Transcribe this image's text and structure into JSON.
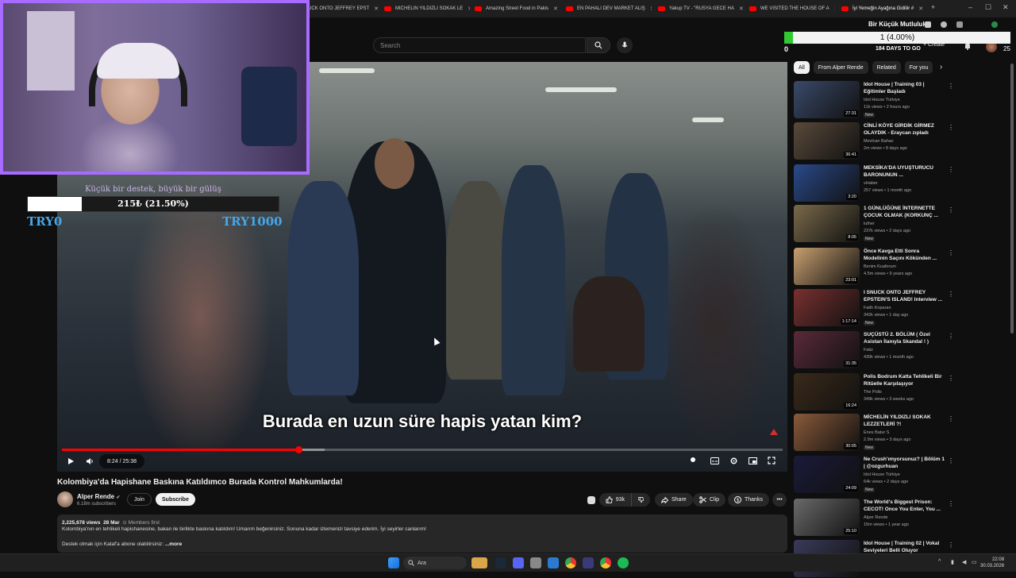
{
  "browser": {
    "tabs": [
      {
        "label": "UCK ONTO JEFFREY EPST"
      },
      {
        "label": "MICHELIN YILDIZLI SOKAK LE"
      },
      {
        "label": "Amazing Street Food in Pakis"
      },
      {
        "label": "EN PAHALI DEV MARKET ALIŞ"
      },
      {
        "label": "Yakup TV - \"RUSYA GECE HA"
      },
      {
        "label": "WE VISITED THE HOUSE OF A"
      },
      {
        "label": "İyi Yemeğin Ayağına Gidiliir #"
      }
    ],
    "new_tab": "+",
    "min": "–",
    "max": "☐",
    "close": "✕"
  },
  "youtube": {
    "search_placeholder": "Search",
    "create_label": "+ Create",
    "notif_count": "9+"
  },
  "overlay_goal": {
    "title": "Bir Küçük Mutluluk",
    "progress_text": "1 (4.00%)",
    "progress_percent": 4,
    "left_value": "0",
    "right_value": "25",
    "days_left": "184 DAYS TO GO"
  },
  "donation": {
    "title": "Küçük bir destek, büyük bir gülüş",
    "progress_text": "215₺ (21.50%)",
    "progress_percent": 21.5,
    "min_label": "TRY0",
    "max_label": "TRY1000"
  },
  "video": {
    "subtitle": "Burada en uzun süre hapis yatan kim?",
    "time": "8:24 / 25:38",
    "progress_percent": 32.8,
    "buffered_percent": 36.5,
    "title": "Kolombiya'da Hapishane Baskına Katıldımco Burada Kontrol Mahkumlarda!"
  },
  "channel": {
    "name": "Alper Rende",
    "subs": "6.18m subscribers",
    "join": "Join",
    "subscribe": "Subscribe"
  },
  "actions": {
    "likes": "93k",
    "share": "Share",
    "clip": "Clip",
    "thanks": "Thanks",
    "more": "•••"
  },
  "description": {
    "views": "2,225,678 views",
    "date": "28 Mar",
    "members": "Members first",
    "line1": "Kolombiya'nın en tehlikeli hapishanesine, bakan ile birlikte baskına katıldım! Umarım beğenirsiniz. Sonuna kadar izlemenizi tavsiye ederim. İyi seyirler canlarım!",
    "line2": "Destek olmak için Kataf'a abone olabilirsiniz:",
    "more": "...more"
  },
  "sidebar": {
    "chips": [
      {
        "label": "All"
      },
      {
        "label": "From Alper Rende"
      },
      {
        "label": "Related"
      },
      {
        "label": "For you"
      }
    ],
    "recs": [
      {
        "title": "Idol House | Training 03 | Eğitimler Başladı",
        "channel": "Idol House Türkiye",
        "meta": "11k views • 2 hours ago",
        "badge": "New",
        "dur": "27:31",
        "color": "#3a4a6a"
      },
      {
        "title": "CİNLİ KÖYE GİRDİK GİRMEZ OLAYDIK - Eraycan zıpladı",
        "channel": "Mevlcan Bahav",
        "meta": "2m views • 8 days ago",
        "badge": "",
        "dur": "36:41",
        "color": "#5a4a3a"
      },
      {
        "title": "MEKSİKA'DA UYUŞTURUCU BARONUNUN ...",
        "channel": "vHaber",
        "meta": "257 views • 1 month ago",
        "badge": "",
        "dur": "3:20",
        "color": "#2a4a8a"
      },
      {
        "title": "1 GÜNLÜĞÜNE İNTERNETTE ÇOCUK OLMAK (KORKUNÇ ...",
        "channel": "luther",
        "meta": "237k views • 2 days ago",
        "badge": "New",
        "dur": "8:05",
        "color": "#7a6a4a"
      },
      {
        "title": "Önce Kavga Etti Sonra Modelinin Saçını Kökünden ...",
        "channel": "Benim Kuaforum",
        "meta": "4.5m views • 9 years ago",
        "badge": "",
        "dur": "23:01",
        "color": "#c8a070"
      },
      {
        "title": "I SNUCK ONTO JEFFREY EPSTEIN'S ISLAND! Interview ...",
        "channel": "Fatih Koparan",
        "meta": "342k views • 1 day ago",
        "badge": "New",
        "dur": "1:17:14",
        "color": "#7a3030"
      },
      {
        "title": "SUÇÜSTÜ 2. BÖLÜM ( Özel Asistan İlanıyla Skandal ! )",
        "channel": "Fatiz",
        "meta": "430k views • 1 month ago",
        "badge": "",
        "dur": "31:35",
        "color": "#5a2a3a"
      },
      {
        "title": "Polis Bodrum Katta Tehlikeli Bir Ritüelle Karşılaşıyor",
        "channel": "The Polis",
        "meta": "349k views • 3 weeks ago",
        "badge": "",
        "dur": "16:24",
        "color": "#3a2a1a"
      },
      {
        "title": "MİCHELİN YILDIZLI SOKAK LEZZETLERİ ?!",
        "channel": "Enes Batur S",
        "meta": "2.9m views • 3 days ago",
        "badge": "New",
        "dur": "30:05",
        "color": "#8a5a3a"
      },
      {
        "title": "Ne Crush'ımyorsunuz? | Bölüm 1 | @ozgurhuan",
        "channel": "Idol House Türkiye",
        "meta": "64k views • 2 days ago",
        "badge": "New",
        "dur": "24:09",
        "color": "#1a1a3a"
      },
      {
        "title": "The World's Biggest Prison: CECOT! Once You Enter, You ...",
        "channel": "Alper Rende",
        "meta": "15m views • 1 year ago",
        "badge": "",
        "dur": "25:10",
        "color": "#6a6a6a"
      },
      {
        "title": "Idol House | Training 02 | Vokal Seviyeleri Belli Oluyor",
        "channel": "Idol House Türkiye",
        "meta": "",
        "badge": "",
        "dur": "",
        "color": "#3a3a5a"
      }
    ]
  },
  "taskbar": {
    "search": "Ara",
    "time": "22:08",
    "date": "30.03.2026"
  }
}
